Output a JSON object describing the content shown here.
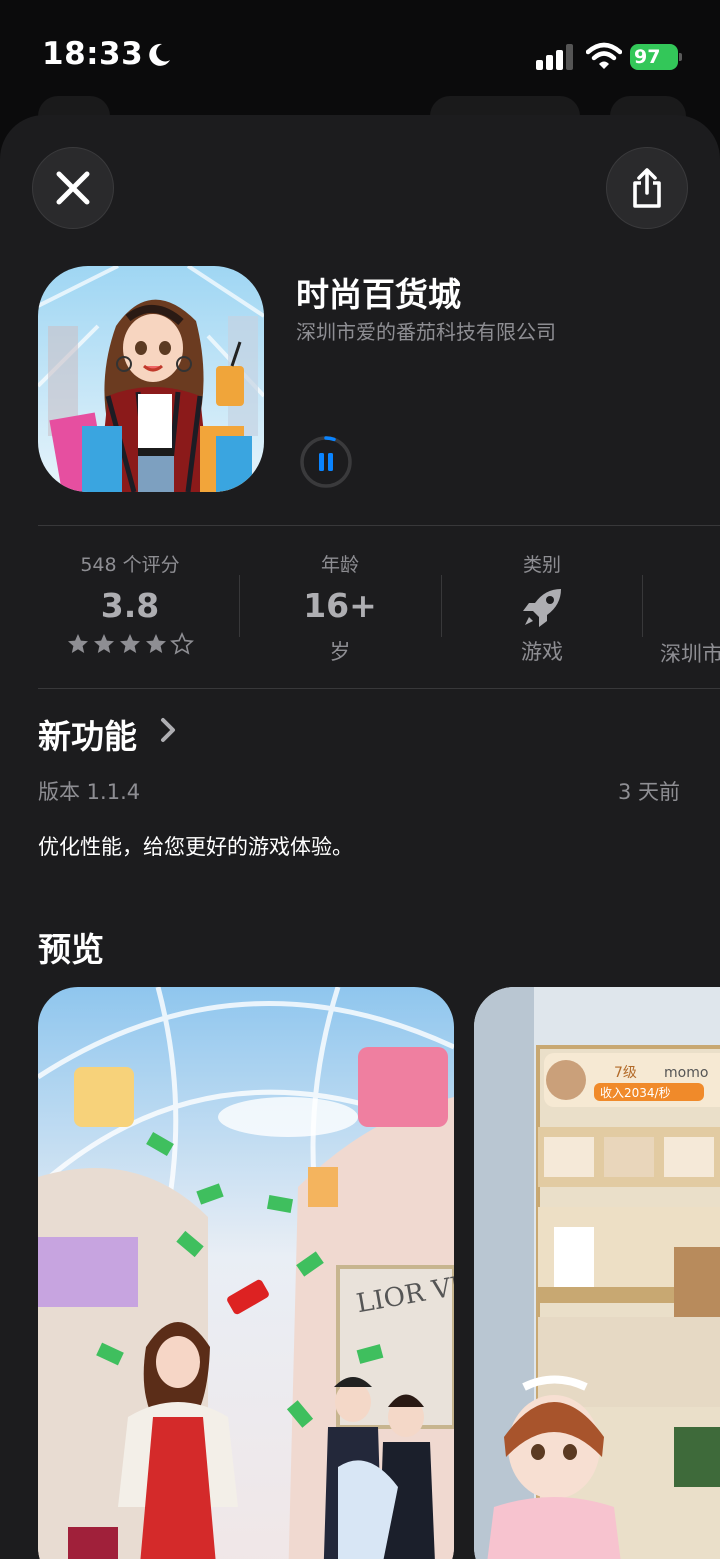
{
  "status_bar": {
    "time": "18:33",
    "battery": "97"
  },
  "app": {
    "title": "时尚百货城",
    "developer": "深圳市爱的番茄科技有限公司"
  },
  "info": {
    "ratings": {
      "label": "548 个评分",
      "value": "3.8",
      "stars": 3.8
    },
    "age": {
      "label": "年龄",
      "value": "16+",
      "sub": "岁"
    },
    "category": {
      "label": "类别",
      "sub": "游戏"
    },
    "developer_short": "深圳市"
  },
  "whats_new": {
    "title": "新功能",
    "version": "版本 1.1.4",
    "ago": "3 天前",
    "notes": "优化性能，给您更好的游戏体验。"
  },
  "preview": {
    "title": "预览",
    "shot2": {
      "level": "7级",
      "name": "momo",
      "income": "收入2034/秒"
    }
  },
  "colors": {
    "accent": "#0a84ff",
    "battery": "#33c759",
    "sheet": "#1c1c1e"
  }
}
